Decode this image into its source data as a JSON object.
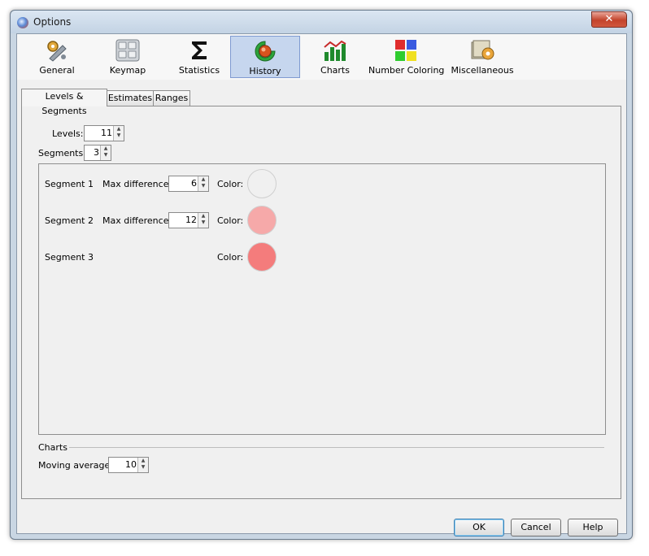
{
  "window": {
    "title": "Options"
  },
  "toolbar": {
    "items": [
      {
        "label": "General",
        "icon": "wrench-gear-icon"
      },
      {
        "label": "Keymap",
        "icon": "keyboard-icon"
      },
      {
        "label": "Statistics",
        "icon": "sigma-icon"
      },
      {
        "label": "History",
        "icon": "history-icon",
        "selected": true
      },
      {
        "label": "Charts",
        "icon": "bar-chart-icon"
      },
      {
        "label": "Number Coloring",
        "icon": "color-squares-icon"
      },
      {
        "label": "Miscellaneous",
        "icon": "miscellaneous-gear-icon"
      }
    ]
  },
  "tabs": [
    "Levels & Segments",
    "Estimates",
    "Ranges"
  ],
  "levels": {
    "label": "Levels:",
    "value": "11"
  },
  "segments": {
    "label": "Segments:",
    "value": "3"
  },
  "segment_rows": [
    {
      "name": "Segment 1",
      "max_label": "Max difference:",
      "max_value": "6",
      "color_label": "Color:",
      "color": "#f0f0f0"
    },
    {
      "name": "Segment 2",
      "max_label": "Max difference:",
      "max_value": "12",
      "color_label": "Color:",
      "color": "#f6a9a9"
    },
    {
      "name": "Segment 3",
      "color_label": "Color:",
      "color": "#f47c7c"
    }
  ],
  "charts": {
    "section_label": "Charts",
    "moving_average_label": "Moving average:",
    "moving_average_value": "10"
  },
  "buttons": {
    "ok": "OK",
    "cancel": "Cancel",
    "help": "Help"
  },
  "colors": {
    "selected_tab_bg": "#c6d6ee",
    "accent": "#3c7fb1"
  }
}
